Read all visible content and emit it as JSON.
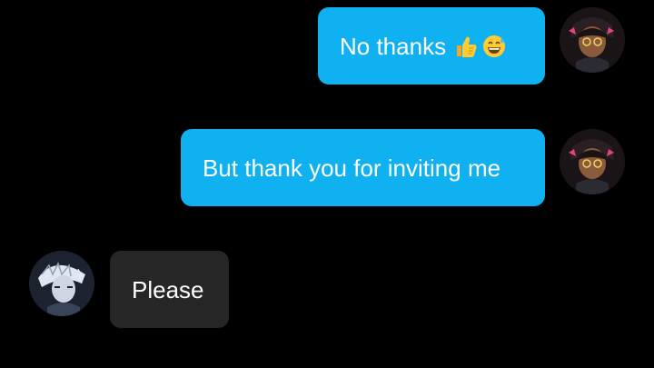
{
  "conversation": {
    "messages": [
      {
        "sender": "me",
        "text": "No thanks",
        "emoji": [
          "thumbs-up-icon",
          "grinning-sweat-icon"
        ]
      },
      {
        "sender": "me",
        "text": "But thank you for inviting me"
      },
      {
        "sender": "other",
        "text": "Please"
      }
    ]
  },
  "colors": {
    "background": "#000000",
    "outgoing_bubble": "#10b1f0",
    "incoming_bubble": "#262626",
    "text": "#ffffff"
  }
}
